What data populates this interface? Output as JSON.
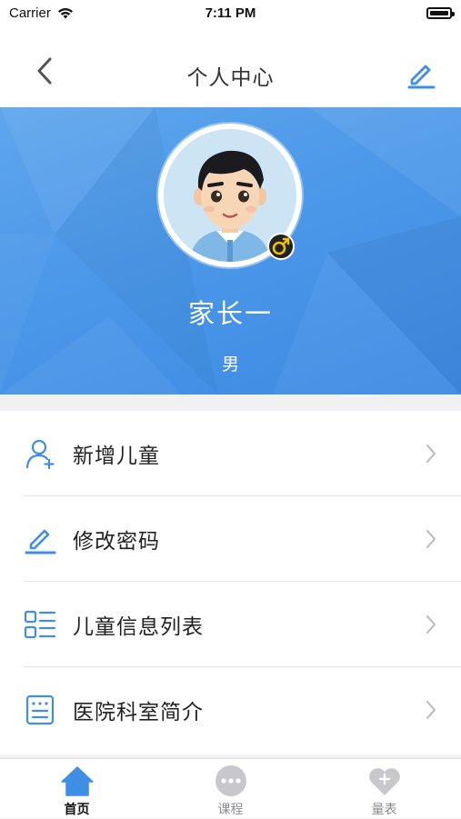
{
  "status_bar": {
    "carrier": "Carrier",
    "time": "7:11 PM"
  },
  "nav": {
    "title": "个人中心",
    "back_icon": "chevron-left-icon",
    "edit_icon": "pencil-icon"
  },
  "profile": {
    "name": "家长一",
    "gender": "男",
    "gender_icon": "male-symbol-icon"
  },
  "menu": {
    "items": [
      {
        "label": "新增儿童",
        "icon": "add-user-icon"
      },
      {
        "label": "修改密码",
        "icon": "pencil-icon"
      },
      {
        "label": "儿童信息列表",
        "icon": "list-icon"
      },
      {
        "label": "医院科室简介",
        "icon": "document-icon"
      }
    ]
  },
  "tabbar": {
    "tabs": [
      {
        "label": "首页",
        "icon": "home-icon",
        "active": true
      },
      {
        "label": "课程",
        "icon": "chat-bubble-icon",
        "active": false
      },
      {
        "label": "量表",
        "icon": "heart-plus-icon",
        "active": false
      }
    ]
  },
  "colors": {
    "accent": "#3f8ee6",
    "header_bg": "#4b97e9",
    "inactive_icon": "#c7c7cc"
  }
}
